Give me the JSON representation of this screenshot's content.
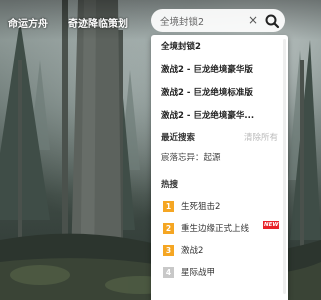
{
  "nav": {
    "items": [
      "命运方舟",
      "奇迹降临策划"
    ]
  },
  "search": {
    "value": "全境封锁2",
    "clear_icon": "×",
    "icon": "search-icon"
  },
  "dropdown": {
    "suggestions": [
      "全境封锁2",
      "激战2 - 巨龙绝境豪华版",
      "激战2 - 巨龙绝境标准版",
      "激战2 - 巨龙绝境豪华..."
    ],
    "recent_label": "最近搜索",
    "clear_all_label": "清除所有",
    "recent_items": [
      "宸落忘异：起源"
    ],
    "hot_label": "热搜",
    "hot_items": [
      {
        "rank": "1",
        "text": "生死狙击2",
        "badge": ""
      },
      {
        "rank": "2",
        "text": "重生边缘正式上线",
        "badge": "NEW"
      },
      {
        "rank": "3",
        "text": "激战2",
        "badge": ""
      },
      {
        "rank": "4",
        "text": "星际战甲",
        "badge": ""
      }
    ]
  },
  "colors": {
    "rank_top": "#f5a623",
    "rank_other": "#c8c8c8",
    "badge": "#e8232a"
  }
}
